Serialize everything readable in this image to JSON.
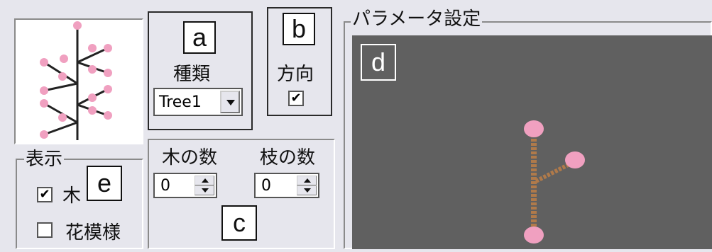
{
  "markers": {
    "a": "a",
    "b": "b",
    "c": "c",
    "d": "d",
    "e": "e"
  },
  "type_group": {
    "label": "種類",
    "combo_value": "Tree1"
  },
  "direction_group": {
    "label": "方向",
    "checked": true
  },
  "counts": {
    "tree_label": "木の数",
    "branch_label": "枝の数",
    "tree_value": "0",
    "branch_value": "0"
  },
  "display_group": {
    "legend": "表示",
    "tree_label": "木",
    "flower_label": "花模様",
    "tree_checked": true,
    "flower_checked": false
  },
  "params": {
    "legend": "パラメータ設定",
    "canvas_color": "#606060"
  },
  "colors": {
    "blossom": "#f0a0c0",
    "branch": "#b07a4a",
    "trunk": "#222222"
  },
  "icons": {
    "check": "checkmark-icon",
    "combo": "chevron-down-icon"
  }
}
